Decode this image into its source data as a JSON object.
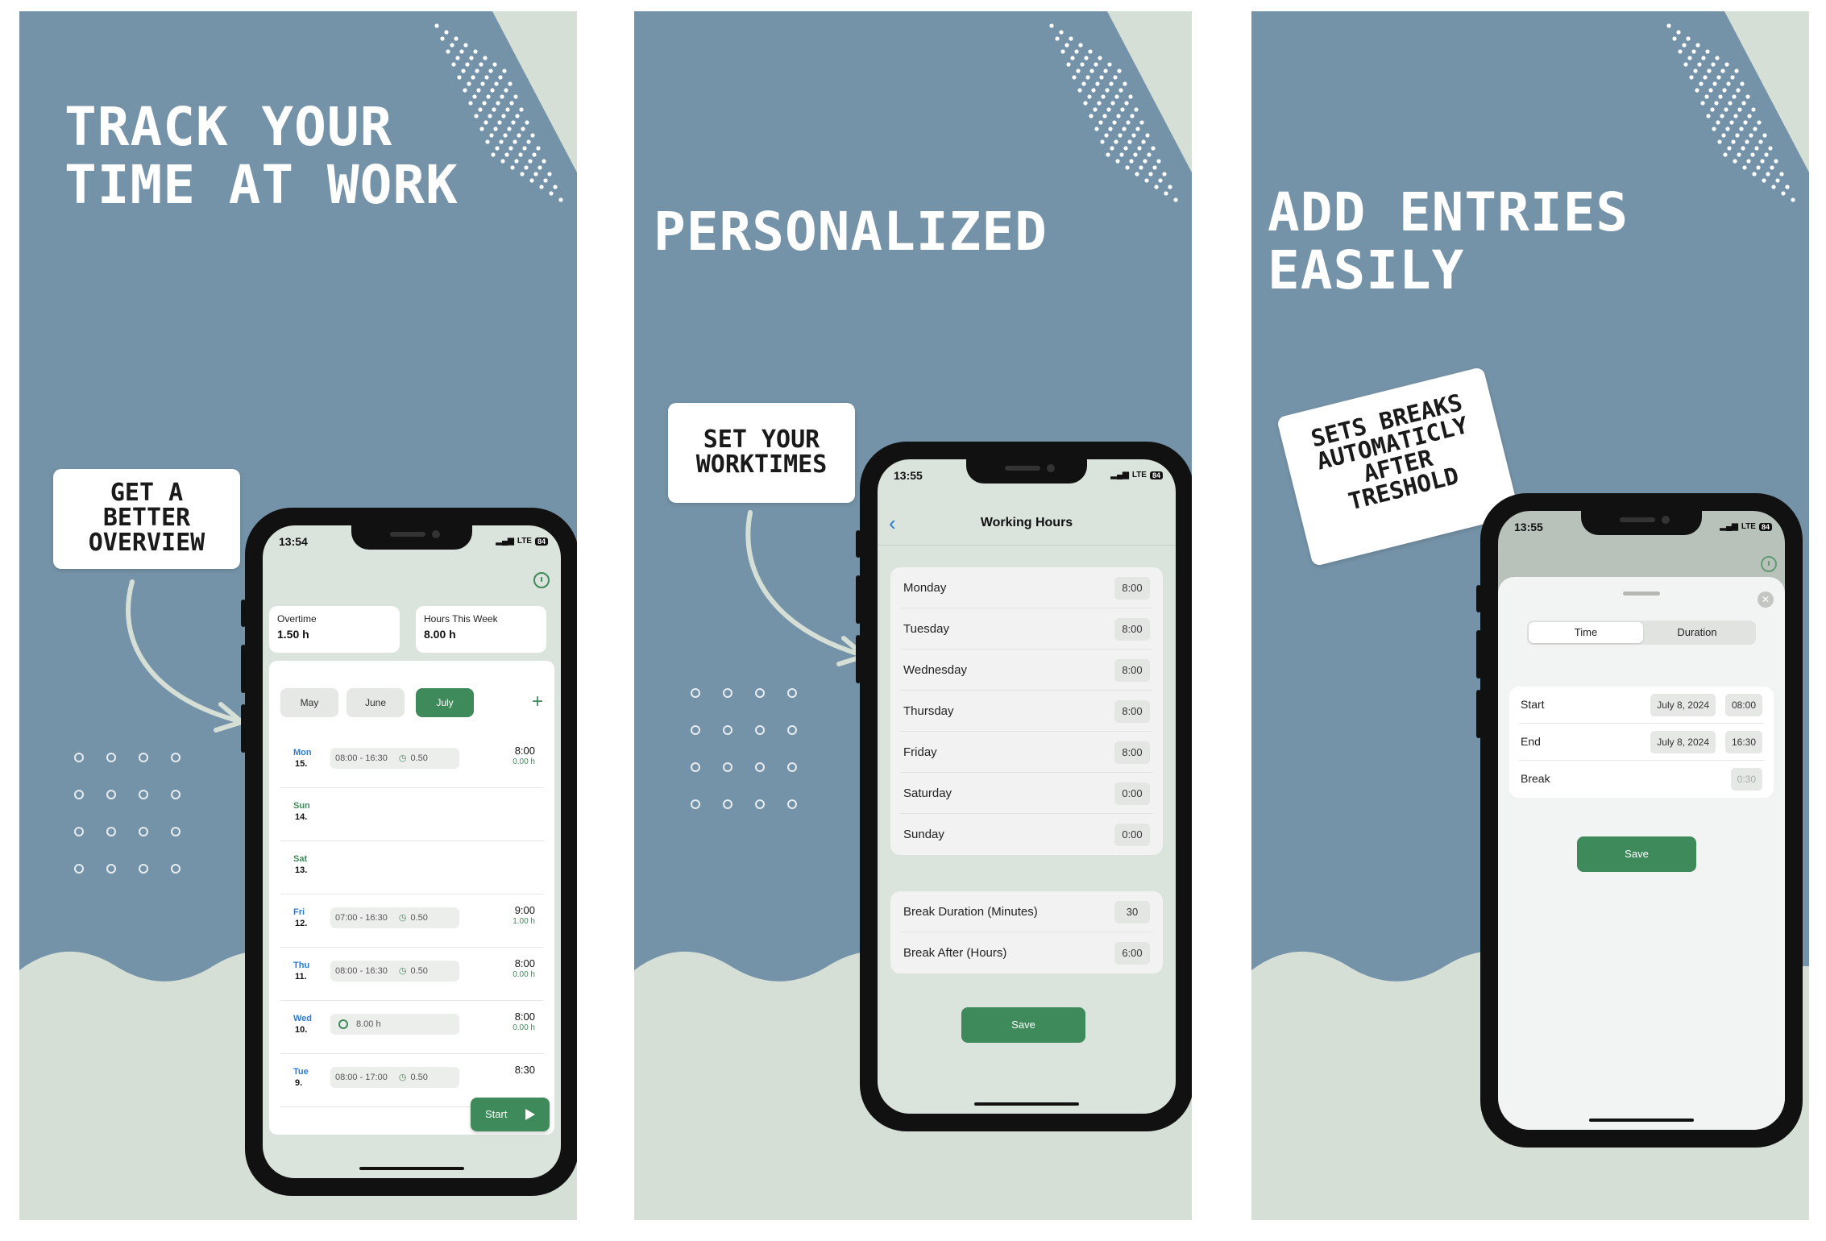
{
  "colors": {
    "panel_bg": "#7593a8",
    "wave": "#d5dfd6",
    "accent_green": "#3f8a5a",
    "weekday_blue": "#2b7bd6"
  },
  "panel1": {
    "headline": "TRACK YOUR\nTIME AT WORK",
    "callout": "GET A\nBETTER\nOVERVIEW",
    "phone": {
      "status_time": "13:54",
      "network": "LTE",
      "battery": "84",
      "overtime_label": "Overtime",
      "overtime_value": "1.50 h",
      "hours_week_label": "Hours This Week",
      "hours_week_value": "8.00 h",
      "months": [
        "May",
        "June",
        "July"
      ],
      "active_month": "July",
      "add_icon": "plus-icon",
      "days": [
        {
          "name": "Mon",
          "num": "15.",
          "kind": "wk",
          "range": "08:00 - 16:30",
          "break": "0.50",
          "total": "8:00",
          "overtime": "0.00 h"
        },
        {
          "name": "Sun",
          "num": "14.",
          "kind": "we"
        },
        {
          "name": "Sat",
          "num": "13.",
          "kind": "we"
        },
        {
          "name": "Fri",
          "num": "12.",
          "kind": "wk",
          "range": "07:00 - 16:30",
          "break": "0.50",
          "total": "9:00",
          "overtime": "1.00 h"
        },
        {
          "name": "Thu",
          "num": "11.",
          "kind": "wk",
          "range": "08:00 - 16:30",
          "break": "0.50",
          "total": "8:00",
          "overtime": "0.00 h"
        },
        {
          "name": "Wed",
          "num": "10.",
          "kind": "wk",
          "duration": "8.00 h",
          "total": "8:00",
          "overtime": "0.00 h"
        },
        {
          "name": "Tue",
          "num": "9.",
          "kind": "wk",
          "range": "08:00 - 17:00",
          "break": "0.50",
          "total": "8:30"
        }
      ],
      "start_label": "Start"
    }
  },
  "panel2": {
    "headline": "PERSONALIZED",
    "callout": "SET YOUR\nWORKTIMES",
    "phone": {
      "status_time": "13:55",
      "network": "LTE",
      "battery": "84",
      "title": "Working Hours",
      "back_icon": "chevron-left-icon",
      "weekdays": [
        {
          "label": "Monday",
          "value": "8:00"
        },
        {
          "label": "Tuesday",
          "value": "8:00"
        },
        {
          "label": "Wednesday",
          "value": "8:00"
        },
        {
          "label": "Thursday",
          "value": "8:00"
        },
        {
          "label": "Friday",
          "value": "8:00"
        },
        {
          "label": "Saturday",
          "value": "0:00"
        },
        {
          "label": "Sunday",
          "value": "0:00"
        }
      ],
      "break_duration_label": "Break Duration (Minutes)",
      "break_duration_value": "30",
      "break_after_label": "Break After (Hours)",
      "break_after_value": "6:00",
      "save_label": "Save"
    }
  },
  "panel3": {
    "headline": "ADD ENTRIES\nEASILY",
    "callout": "SETS BREAKS\nAUTOMATICLY\nAFTER\nTRESHOLD",
    "phone": {
      "status_time": "13:55",
      "network": "LTE",
      "battery": "84",
      "seg_time": "Time",
      "seg_duration": "Duration",
      "start_label": "Start",
      "start_date": "July 8, 2024",
      "start_time": "08:00",
      "end_label": "End",
      "end_date": "July 8, 2024",
      "end_time": "16:30",
      "break_label": "Break",
      "break_value": "0:30",
      "save_label": "Save"
    }
  }
}
